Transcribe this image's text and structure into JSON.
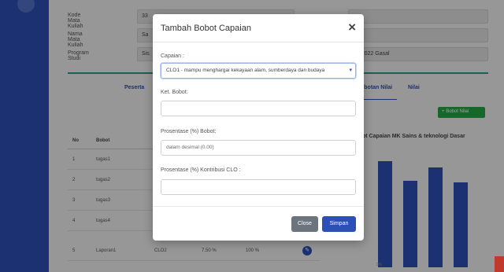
{
  "background": {
    "form": {
      "kode_label": "Kode Mata Kuliah",
      "kode_value": "33",
      "nama_label": "Nama Mata Kuliah",
      "nama_value": "Sa",
      "prodi_label": "Program Studi",
      "prodi_value": "Sis",
      "right_field_1": "",
      "right_field_2": "",
      "right_field_3": "21/2022 Gasal"
    },
    "tabs": {
      "peserta": "Peserta",
      "bobotan": "obotan Nilai",
      "nilai": "Nilai"
    },
    "bobot_button": "Bobot Nilai",
    "table": {
      "headers": [
        "No",
        "Bobot"
      ],
      "rows": [
        {
          "no": "1",
          "bobot": "tugas1",
          "clo": "",
          "persen": "",
          "kontribusi": ""
        },
        {
          "no": "2",
          "bobot": "tugas2",
          "clo": "",
          "persen": "",
          "kontribusi": ""
        },
        {
          "no": "3",
          "bobot": "tugas3",
          "clo": "",
          "persen": "",
          "kontribusi": ""
        },
        {
          "no": "4",
          "bobot": "tugas4",
          "clo": "",
          "persen": "",
          "kontribusi": ""
        },
        {
          "no": "5",
          "bobot": "Laporan1",
          "clo": "CLO2",
          "persen": "7.50 %",
          "kontribusi": "100 %"
        }
      ]
    },
    "chart": {
      "title": "ot Capaian MK Sains & teknologi Dasar",
      "axis_tick": "0%"
    }
  },
  "chart_data": {
    "type": "bar",
    "title": "ot Capaian MK Sains & teknologi Dasar",
    "categories": [
      "",
      "",
      "",
      ""
    ],
    "values": [
      0.95,
      0.77,
      0.89,
      0.76
    ],
    "ylim": [
      0,
      1
    ]
  },
  "modal": {
    "title": "Tambah Bobot Capaian",
    "close_icon": "×",
    "capaian_label": "Capaian :",
    "capaian_value": "CLO1 - mampu menghargai kekayaan alam, sumberdaya dan budaya",
    "ket_label": "Ket. Bobot:",
    "ket_value": "",
    "prosentase_label": "Prosentase (%) Bobot:",
    "prosentase_placeholder": "dalam desimal (0.00)",
    "kontribusi_label": "Prosentase (%) Kontribusi CLO :",
    "kontribusi_value": "",
    "close_button": "Close",
    "save_button": "Simpan"
  },
  "colors": {
    "primary": "#2d4fb8",
    "success": "#28a745",
    "secondary": "#6c757d",
    "accent_line": "#2a9d8f"
  }
}
